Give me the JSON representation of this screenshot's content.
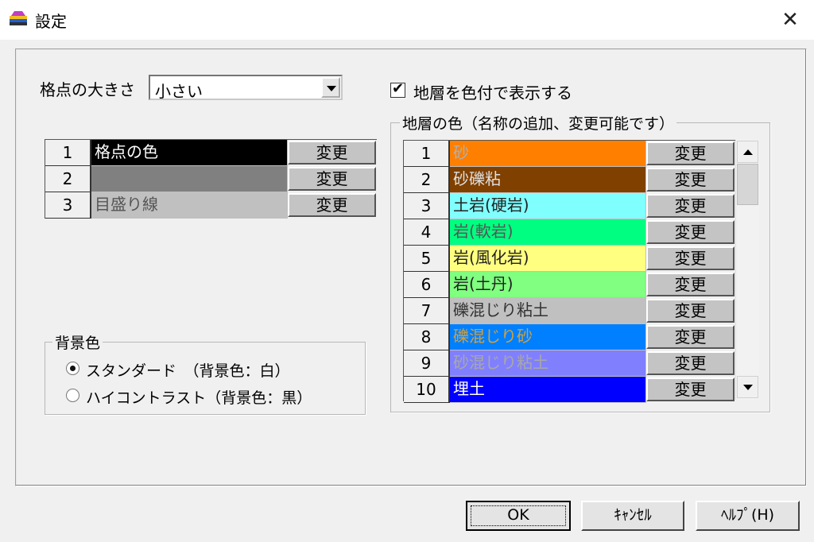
{
  "window": {
    "title": "設定",
    "icon": "app-icon",
    "close_symbol": "✕"
  },
  "grid_size": {
    "label": "格点の大きさ",
    "selected": "小さい"
  },
  "show_colored": {
    "label": "地層を色付で表示する",
    "checked": true,
    "check_symbol": "✔"
  },
  "grid_colors": {
    "rows": [
      {
        "num": "1",
        "name": "格点の色",
        "bg": "#000000",
        "fg": "#ffffff",
        "button": "変更"
      },
      {
        "num": "2",
        "name": "",
        "bg": "#808080",
        "fg": "#000000",
        "button": "変更"
      },
      {
        "num": "3",
        "name": "目盛り線",
        "bg": "#c0c0c0",
        "fg": "#555555",
        "button": "変更"
      }
    ]
  },
  "strata": {
    "group_title": "地層の色（名称の追加、変更可能です）",
    "rows": [
      {
        "num": "1",
        "name": "砂",
        "bg": "#ff8000",
        "fg": "#b0b0b0",
        "button": "変更"
      },
      {
        "num": "2",
        "name": "砂礫粘",
        "bg": "#804000",
        "fg": "#e0e0e0",
        "button": "変更"
      },
      {
        "num": "3",
        "name": "土岩(硬岩)",
        "bg": "#80ffff",
        "fg": "#222222",
        "button": "変更"
      },
      {
        "num": "4",
        "name": "岩(軟岩)",
        "bg": "#00ff80",
        "fg": "#555555",
        "button": "変更"
      },
      {
        "num": "5",
        "name": "岩(風化岩)",
        "bg": "#ffff80",
        "fg": "#222222",
        "button": "変更"
      },
      {
        "num": "6",
        "name": "岩(土丹)",
        "bg": "#80ff80",
        "fg": "#222222",
        "button": "変更"
      },
      {
        "num": "7",
        "name": "礫混じり粘土",
        "bg": "#c0c0c0",
        "fg": "#333333",
        "button": "変更"
      },
      {
        "num": "8",
        "name": "礫混じり砂",
        "bg": "#0080ff",
        "fg": "#d0a040",
        "button": "変更"
      },
      {
        "num": "9",
        "name": "砂混じり粘土",
        "bg": "#8080ff",
        "fg": "#a8a8a8",
        "button": "変更"
      },
      {
        "num": "10",
        "name": "埋土",
        "bg": "#0000ff",
        "fg": "#ffffff",
        "button": "変更"
      }
    ]
  },
  "background": {
    "group_title": "背景色",
    "options": [
      {
        "label": "スタンダード　（背景色：白）",
        "selected": true
      },
      {
        "label": "ハイコントラスト（背景色：黒）",
        "selected": false
      }
    ]
  },
  "buttons": {
    "ok": "OK",
    "cancel": "ｷｬﾝｾﾙ",
    "help": "ﾍﾙﾌﾟ(H)"
  }
}
